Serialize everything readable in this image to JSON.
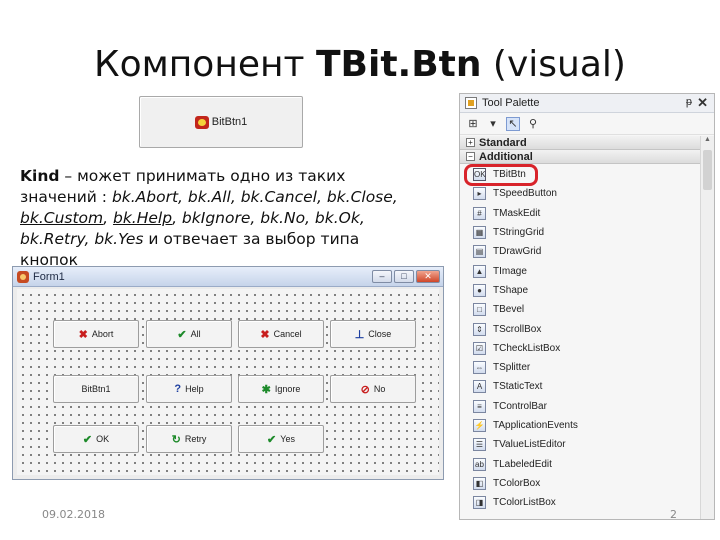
{
  "slide": {
    "title_prefix": "Компонент ",
    "title_bold": "TBit.Btn",
    "title_suffix": " (visual)",
    "date": "09.02.2018",
    "page_number": "2"
  },
  "demo_button": {
    "label": "BitBtn1"
  },
  "paragraph": {
    "kind_word": "Kind",
    "intro": " – может принимать одно из таких значений : ",
    "values_plain": "bk.Abort, bk.All, bk.Cancel, bk.Close, ",
    "value_custom": "bk.Custom",
    "sep": ", ",
    "value_help": "bk.Help",
    "values_rest": ", bkIgnore, bk.No, bk.Ok, bk.Retry, bk.Yes",
    "outro": " и отвечает за выбор типа кнопок"
  },
  "form": {
    "title": "Form1",
    "controls": {
      "minimize": "–",
      "maximize": "□",
      "close": "✕"
    },
    "buttons": [
      {
        "label": "Abort",
        "glyph": "✖",
        "color": "red"
      },
      {
        "label": "All",
        "glyph": "✔",
        "color": "green"
      },
      {
        "label": "Cancel",
        "glyph": "✖",
        "color": "red"
      },
      {
        "label": "Close",
        "glyph": "⊥",
        "color": "blue"
      },
      {
        "label": "BitBtn1",
        "glyph": "",
        "color": "black"
      },
      {
        "label": "Help",
        "glyph": "?",
        "color": "blue"
      },
      {
        "label": "Ignore",
        "glyph": "✱",
        "color": "green"
      },
      {
        "label": "No",
        "glyph": "⊘",
        "color": "red"
      },
      {
        "label": "OK",
        "glyph": "✔",
        "color": "green"
      },
      {
        "label": "Retry",
        "glyph": "↻",
        "color": "green"
      },
      {
        "label": "Yes",
        "glyph": "✔",
        "color": "green"
      }
    ]
  },
  "palette": {
    "title": "Tool Palette",
    "pin": "ᵽ",
    "close": "✕",
    "categories": [
      "Standard",
      "Additional"
    ],
    "items": [
      "TBitBtn",
      "TSpeedButton",
      "TMaskEdit",
      "TStringGrid",
      "TDrawGrid",
      "TImage",
      "TShape",
      "TBevel",
      "TScrollBox",
      "TCheckListBox",
      "TSplitter",
      "TStaticText",
      "TControlBar",
      "TApplicationEvents",
      "TValueListEditor",
      "TLabeledEdit",
      "TColorBox",
      "TColorListBox"
    ]
  }
}
